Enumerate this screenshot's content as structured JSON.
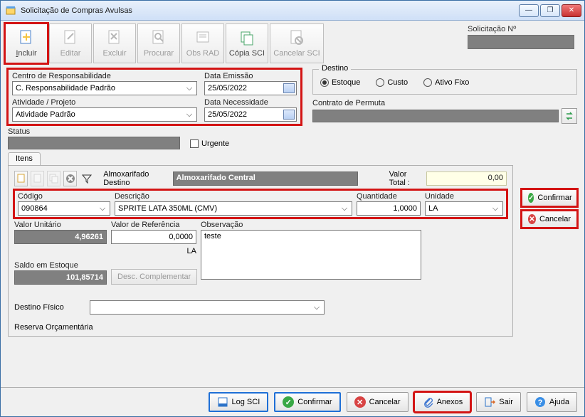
{
  "window": {
    "title": "Solicitação de Compras Avulsas"
  },
  "toolbar": {
    "incluir": "Incluir",
    "editar": "Editar",
    "excluir": "Excluir",
    "procurar": "Procurar",
    "obs_rad": "Obs RAD",
    "copia_sci": "Cópia SCI",
    "cancelar_sci": "Cancelar SCI"
  },
  "solicitacao": {
    "label": "Solicitação Nº",
    "value": ""
  },
  "header": {
    "centro_label": "Centro de Responsabilidade",
    "centro_value": "C. Responsabilidade Padrão",
    "atividade_label": "Atividade / Projeto",
    "atividade_value": "Atividade Padrão",
    "emissao_label": "Data Emissão",
    "emissao_value": "25/05/2022",
    "necessidade_label": "Data Necessidade",
    "necessidade_value": "25/05/2022"
  },
  "destino": {
    "legend": "Destino",
    "estoque": "Estoque",
    "custo": "Custo",
    "ativo": "Ativo Fixo",
    "selected": "estoque"
  },
  "contrato": {
    "label": "Contrato de Permuta",
    "value": ""
  },
  "status": {
    "label": "Status",
    "value": "",
    "urgente_label": "Urgente",
    "urgente_checked": false
  },
  "itens_tab": "Itens",
  "itens_bar": {
    "almox_label": "Almoxarifado Destino",
    "almox_value": "Almoxarifado Central",
    "valor_total_label": "Valor Total :",
    "valor_total_value": "0,00"
  },
  "item": {
    "codigo_label": "Código",
    "codigo_value": "090864",
    "descricao_label": "Descrição",
    "descricao_value": "SPRITE LATA 350ML (CMV)",
    "quantidade_label": "Quantidade",
    "quantidade_value": "1,0000",
    "unidade_label": "Unidade",
    "unidade_value": "LA",
    "valor_unit_label": "Valor Unitário",
    "valor_unit_value": "4,96261",
    "valor_ref_label": "Valor de Referência",
    "valor_ref_value": "0,0000",
    "ref_unit": "LA",
    "obs_label": "Observação",
    "obs_value": "teste",
    "saldo_label": "Saldo em Estoque",
    "saldo_value": "101,85714",
    "desc_compl": "Desc. Complementar",
    "destino_fisico_label": "Destino Físico",
    "destino_fisico_value": "",
    "reserva_label": "Reserva Orçamentária"
  },
  "side": {
    "confirmar": "Confirmar",
    "cancelar": "Cancelar"
  },
  "bottom": {
    "log_sci": "Log SCI",
    "confirmar": "Confirmar",
    "cancelar": "Cancelar",
    "anexos": "Anexos",
    "sair": "Sair",
    "ajuda": "Ajuda"
  }
}
